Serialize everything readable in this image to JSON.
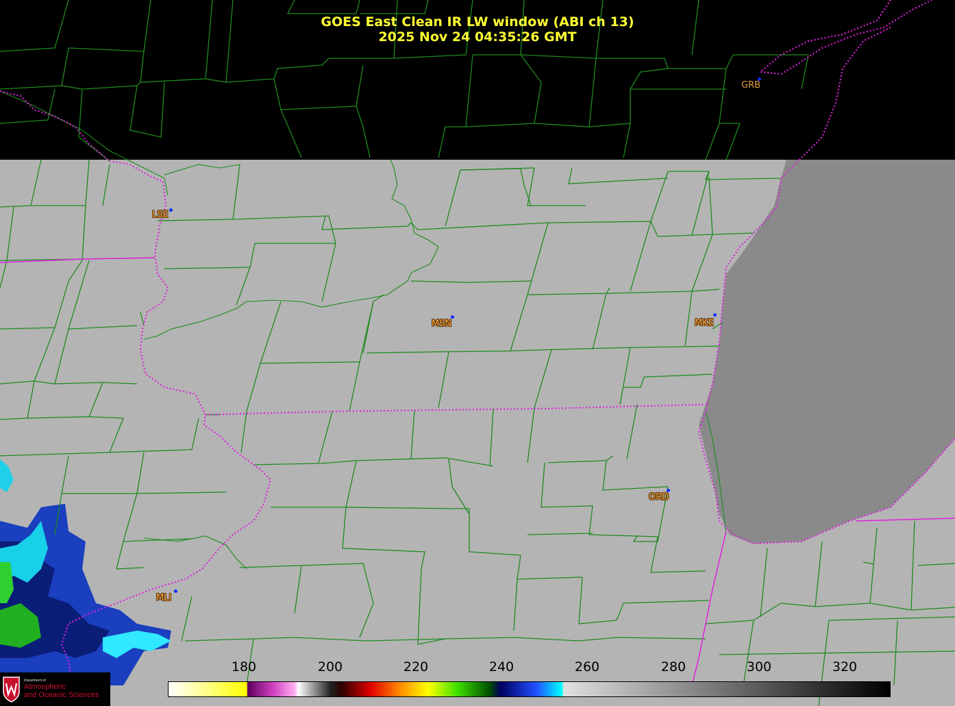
{
  "title": {
    "line1": "GOES East Clean IR LW window (ABI ch 13)",
    "line2": "2025 Nov 24  04:35:26 GMT"
  },
  "stations": [
    {
      "id": "GRB",
      "label": "GRB"
    },
    {
      "id": "LSE",
      "label": "LSE"
    },
    {
      "id": "MSN",
      "label": "MSN"
    },
    {
      "id": "MKE",
      "label": "MKE"
    },
    {
      "id": "ORD",
      "label": "ORD"
    },
    {
      "id": "MLI",
      "label": "MLI"
    }
  ],
  "colorbar": {
    "ticks": [
      "180",
      "200",
      "220",
      "240",
      "260",
      "280",
      "300",
      "320"
    ]
  },
  "logo": {
    "line1": "Department of",
    "line2": "Atmospheric",
    "line3": "and Oceanic Sciences"
  },
  "colors": {
    "title": "#ffff33",
    "county_lines": "#1f8a1f",
    "state_lines": "#e020e0",
    "cloud_free_land": "#b4b4b4",
    "lake": "#8a8a8a",
    "no_data": "#000000",
    "station_label": "#f5b041",
    "station_dot": "#1030ff"
  }
}
